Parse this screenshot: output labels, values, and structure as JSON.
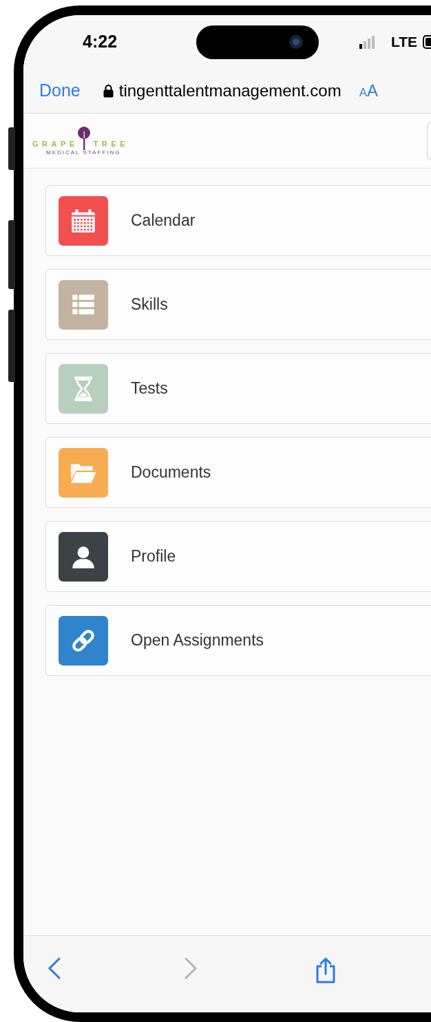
{
  "status_bar": {
    "time": "4:22",
    "network": "LTE"
  },
  "browser_bar": {
    "done": "Done",
    "url": "tingenttalentmanagement.com",
    "text_size": "AA"
  },
  "logo": {
    "word_1": "GRAPE",
    "word_2": "TREE",
    "tagline": "MEDICAL STAFFING"
  },
  "menu": [
    {
      "label": "Calendar",
      "kind": "calendar",
      "color": "#f24f4f"
    },
    {
      "label": "Skills",
      "kind": "list",
      "color": "#c2b4a1"
    },
    {
      "label": "Tests",
      "kind": "hourglass",
      "color": "#b9cfbe"
    },
    {
      "label": "Documents",
      "kind": "folder",
      "color": "#f7ac52"
    },
    {
      "label": "Profile",
      "kind": "person",
      "color": "#3d4246"
    },
    {
      "label": "Open Assignments",
      "kind": "link",
      "color": "#2f84cc"
    }
  ],
  "toolbar": [
    {
      "kind": "back",
      "disabled": false
    },
    {
      "kind": "forward",
      "disabled": true
    },
    {
      "kind": "share",
      "disabled": false
    }
  ]
}
